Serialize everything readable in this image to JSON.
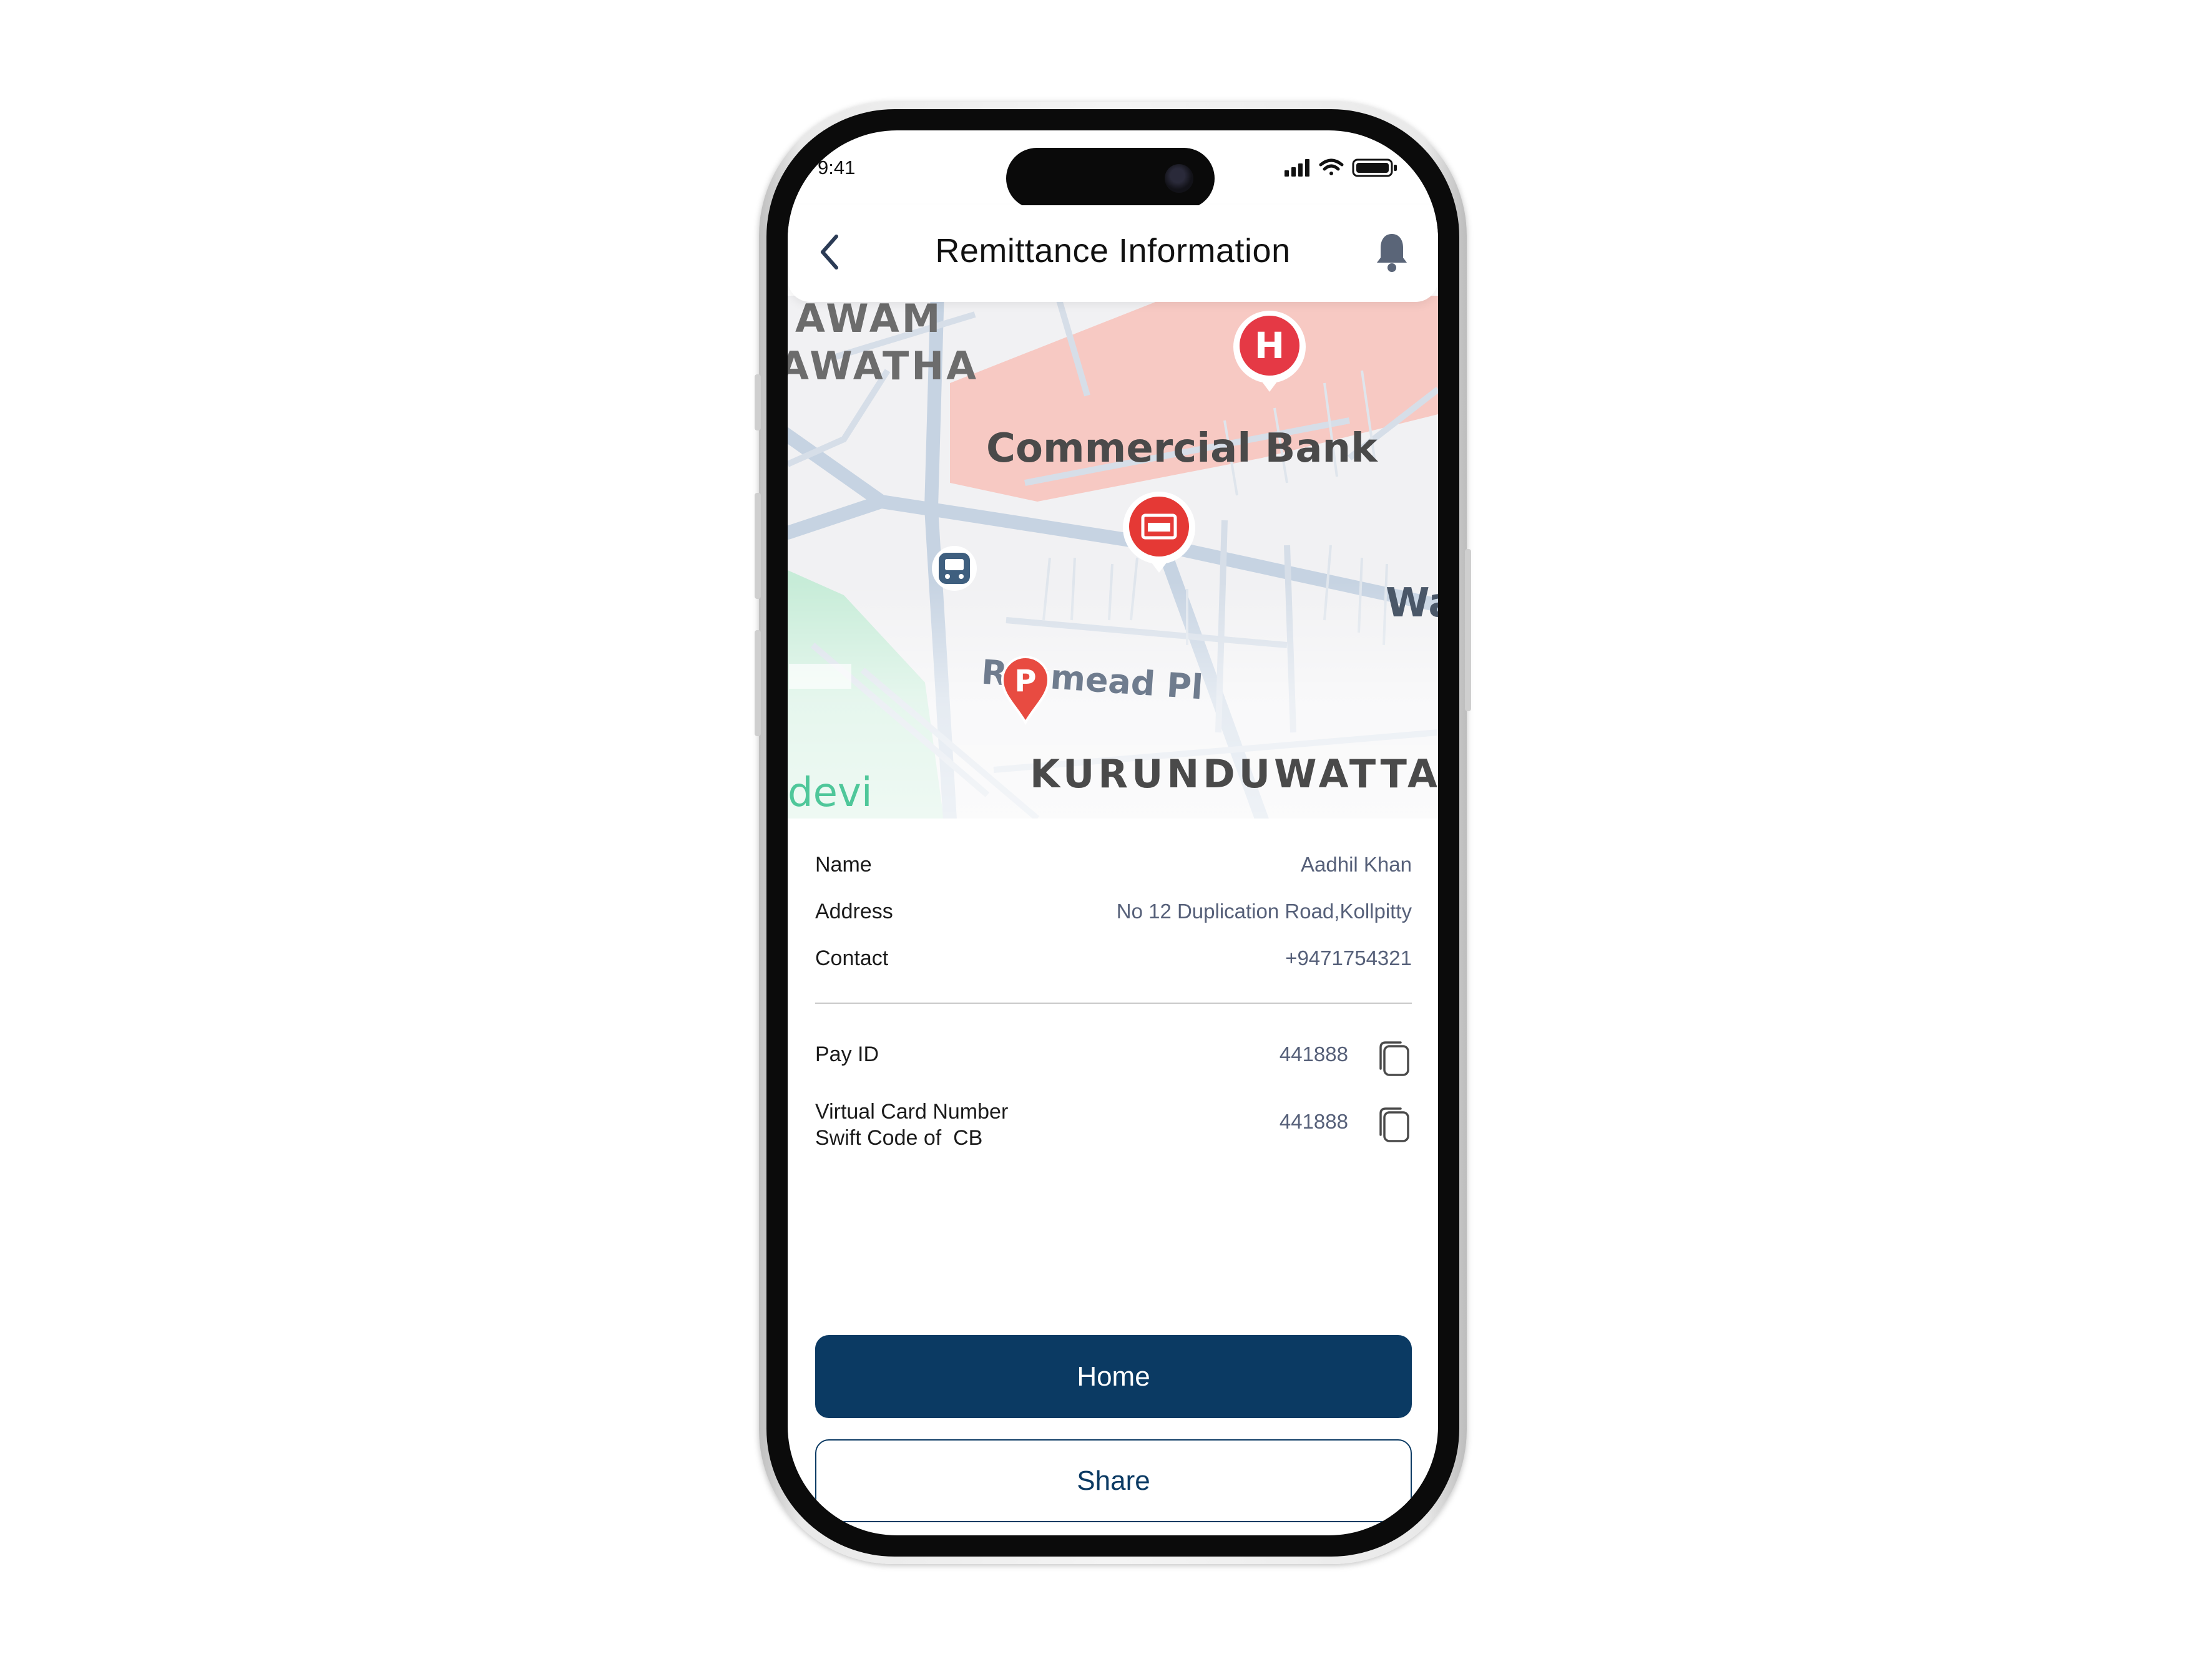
{
  "status_bar": {
    "time": "9:41"
  },
  "header": {
    "title": "Remittance Information",
    "back_icon": "chevron-left-icon",
    "bell_icon": "bell-icon"
  },
  "map": {
    "labels": {
      "awam": "AWAM",
      "awatha": "AWATHA",
      "commercial_bank": "Commercial Bank",
      "wa": "Wa",
      "roomead": "Rosmead Pl",
      "kurunduwatta": "KURUNDUWATTA",
      "devi": "devi"
    },
    "markers": [
      "hospital-marker-icon",
      "bank-marker-icon",
      "bus-stop-icon",
      "parking-marker-icon"
    ],
    "colors": {
      "highlight_area": "#f7c9c3",
      "marker_red": "#e53935",
      "park_green": "#bfe8d3"
    }
  },
  "details": {
    "name_label": "Name",
    "name_value": "Aadhil Khan",
    "address_label": "Address",
    "address_value": "No 12 Duplication Road,Kollpitty",
    "contact_label": "Contact",
    "contact_value": "+9471754321"
  },
  "codes": {
    "payid_label": "Pay ID",
    "payid_value": "441888",
    "vcn_label_line1": "Virtual Card Number",
    "vcn_label_line2": "Swift Code of  CB",
    "vcn_value": "441888"
  },
  "buttons": {
    "home": "Home",
    "share": "Share"
  },
  "colors": {
    "primary": "#0b3a63",
    "value_text": "#566079"
  }
}
